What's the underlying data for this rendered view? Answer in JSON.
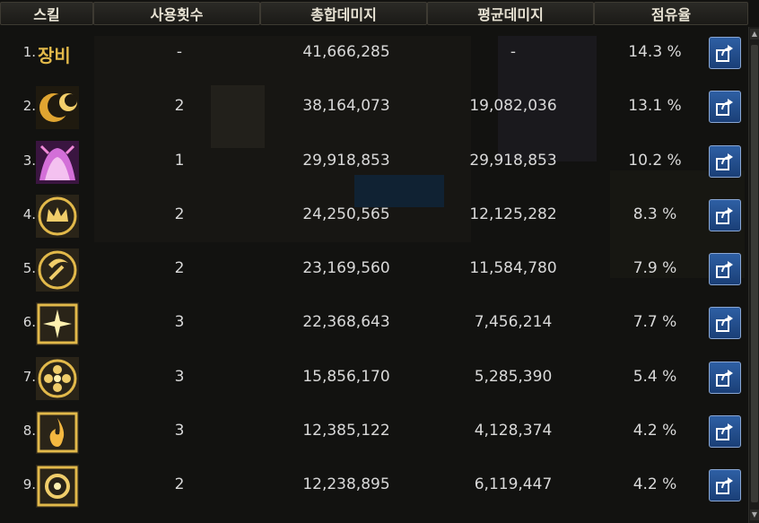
{
  "header": {
    "col_skill": "스킬",
    "col_uses": "사용횟수",
    "col_total": "총합데미지",
    "col_avg": "평균데미지",
    "col_share": "점유율"
  },
  "rows": [
    {
      "rank": "1.",
      "label": "장비",
      "icon": "equipment-text-badge",
      "uses": "-",
      "total": "41,666,285",
      "avg": "-",
      "share": "14.3 %"
    },
    {
      "rank": "2.",
      "label": "",
      "icon": "crescent-moons-skill-icon",
      "uses": "2",
      "total": "38,164,073",
      "avg": "19,082,036",
      "share": "13.1 %"
    },
    {
      "rank": "3.",
      "label": "",
      "icon": "pink-tentacle-skill-icon",
      "uses": "1",
      "total": "29,918,853",
      "avg": "29,918,853",
      "share": "10.2 %"
    },
    {
      "rank": "4.",
      "label": "",
      "icon": "crown-emblem-skill-icon",
      "uses": "2",
      "total": "24,250,565",
      "avg": "12,125,282",
      "share": "8.3 %"
    },
    {
      "rank": "5.",
      "label": "",
      "icon": "crescent-hammer-skill-icon",
      "uses": "2",
      "total": "23,169,560",
      "avg": "11,584,780",
      "share": "7.9 %"
    },
    {
      "rank": "6.",
      "label": "",
      "icon": "starburst-frame-skill-icon",
      "uses": "3",
      "total": "22,368,643",
      "avg": "7,456,214",
      "share": "7.7 %"
    },
    {
      "rank": "7.",
      "label": "",
      "icon": "flower-circle-skill-icon",
      "uses": "3",
      "total": "15,856,170",
      "avg": "5,285,390",
      "share": "5.4 %"
    },
    {
      "rank": "8.",
      "label": "",
      "icon": "flame-frame-skill-icon",
      "uses": "3",
      "total": "12,385,122",
      "avg": "4,128,374",
      "share": "4.2 %"
    },
    {
      "rank": "9.",
      "label": "",
      "icon": "ring-frame-skill-icon",
      "uses": "2",
      "total": "12,238,895",
      "avg": "6,119,447",
      "share": "4.2 %"
    }
  ],
  "colors": {
    "gold": "#e2b94a",
    "share_button": "#2b5a9c"
  }
}
